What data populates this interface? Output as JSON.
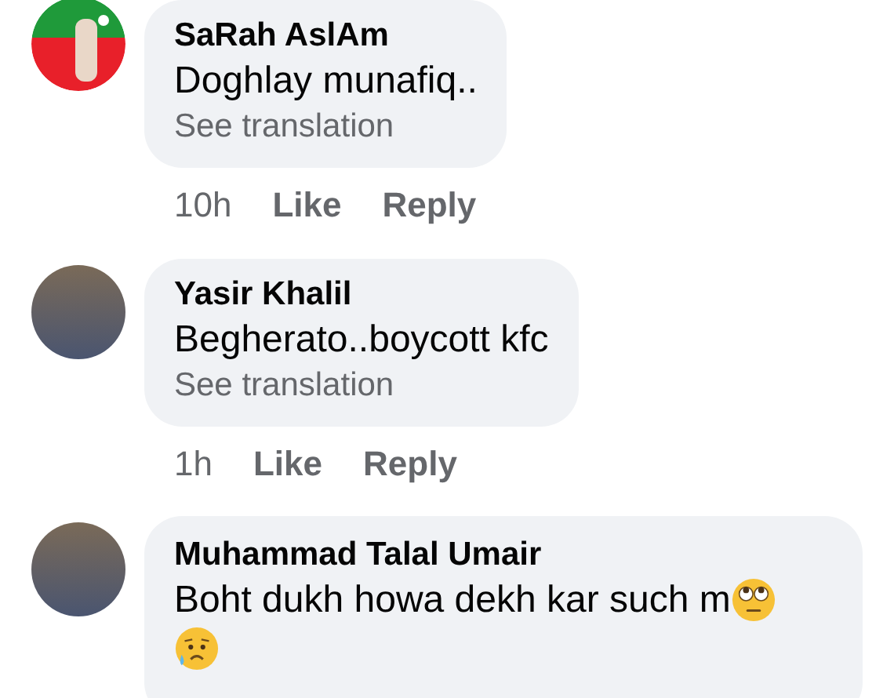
{
  "comments": [
    {
      "avatar": {
        "kind": "flag"
      },
      "author": "SaRah AslAm",
      "text": "Doghlay munafiq..",
      "translate": "See translation",
      "time": "10h",
      "like": "Like",
      "reply": "Reply"
    },
    {
      "avatar": {
        "kind": "photo"
      },
      "author": "Yasir Khalil",
      "text": "Begherato..boycott kfc",
      "translate": "See translation",
      "time": "1h",
      "like": "Like",
      "reply": "Reply"
    },
    {
      "avatar": {
        "kind": "photo"
      },
      "author": "Muhammad Talal Umair",
      "text": "Boht dukh howa dekh kar such m",
      "emojis": [
        {
          "kind": "eye-roll"
        },
        {
          "kind": "sad-sweat"
        }
      ]
    }
  ]
}
